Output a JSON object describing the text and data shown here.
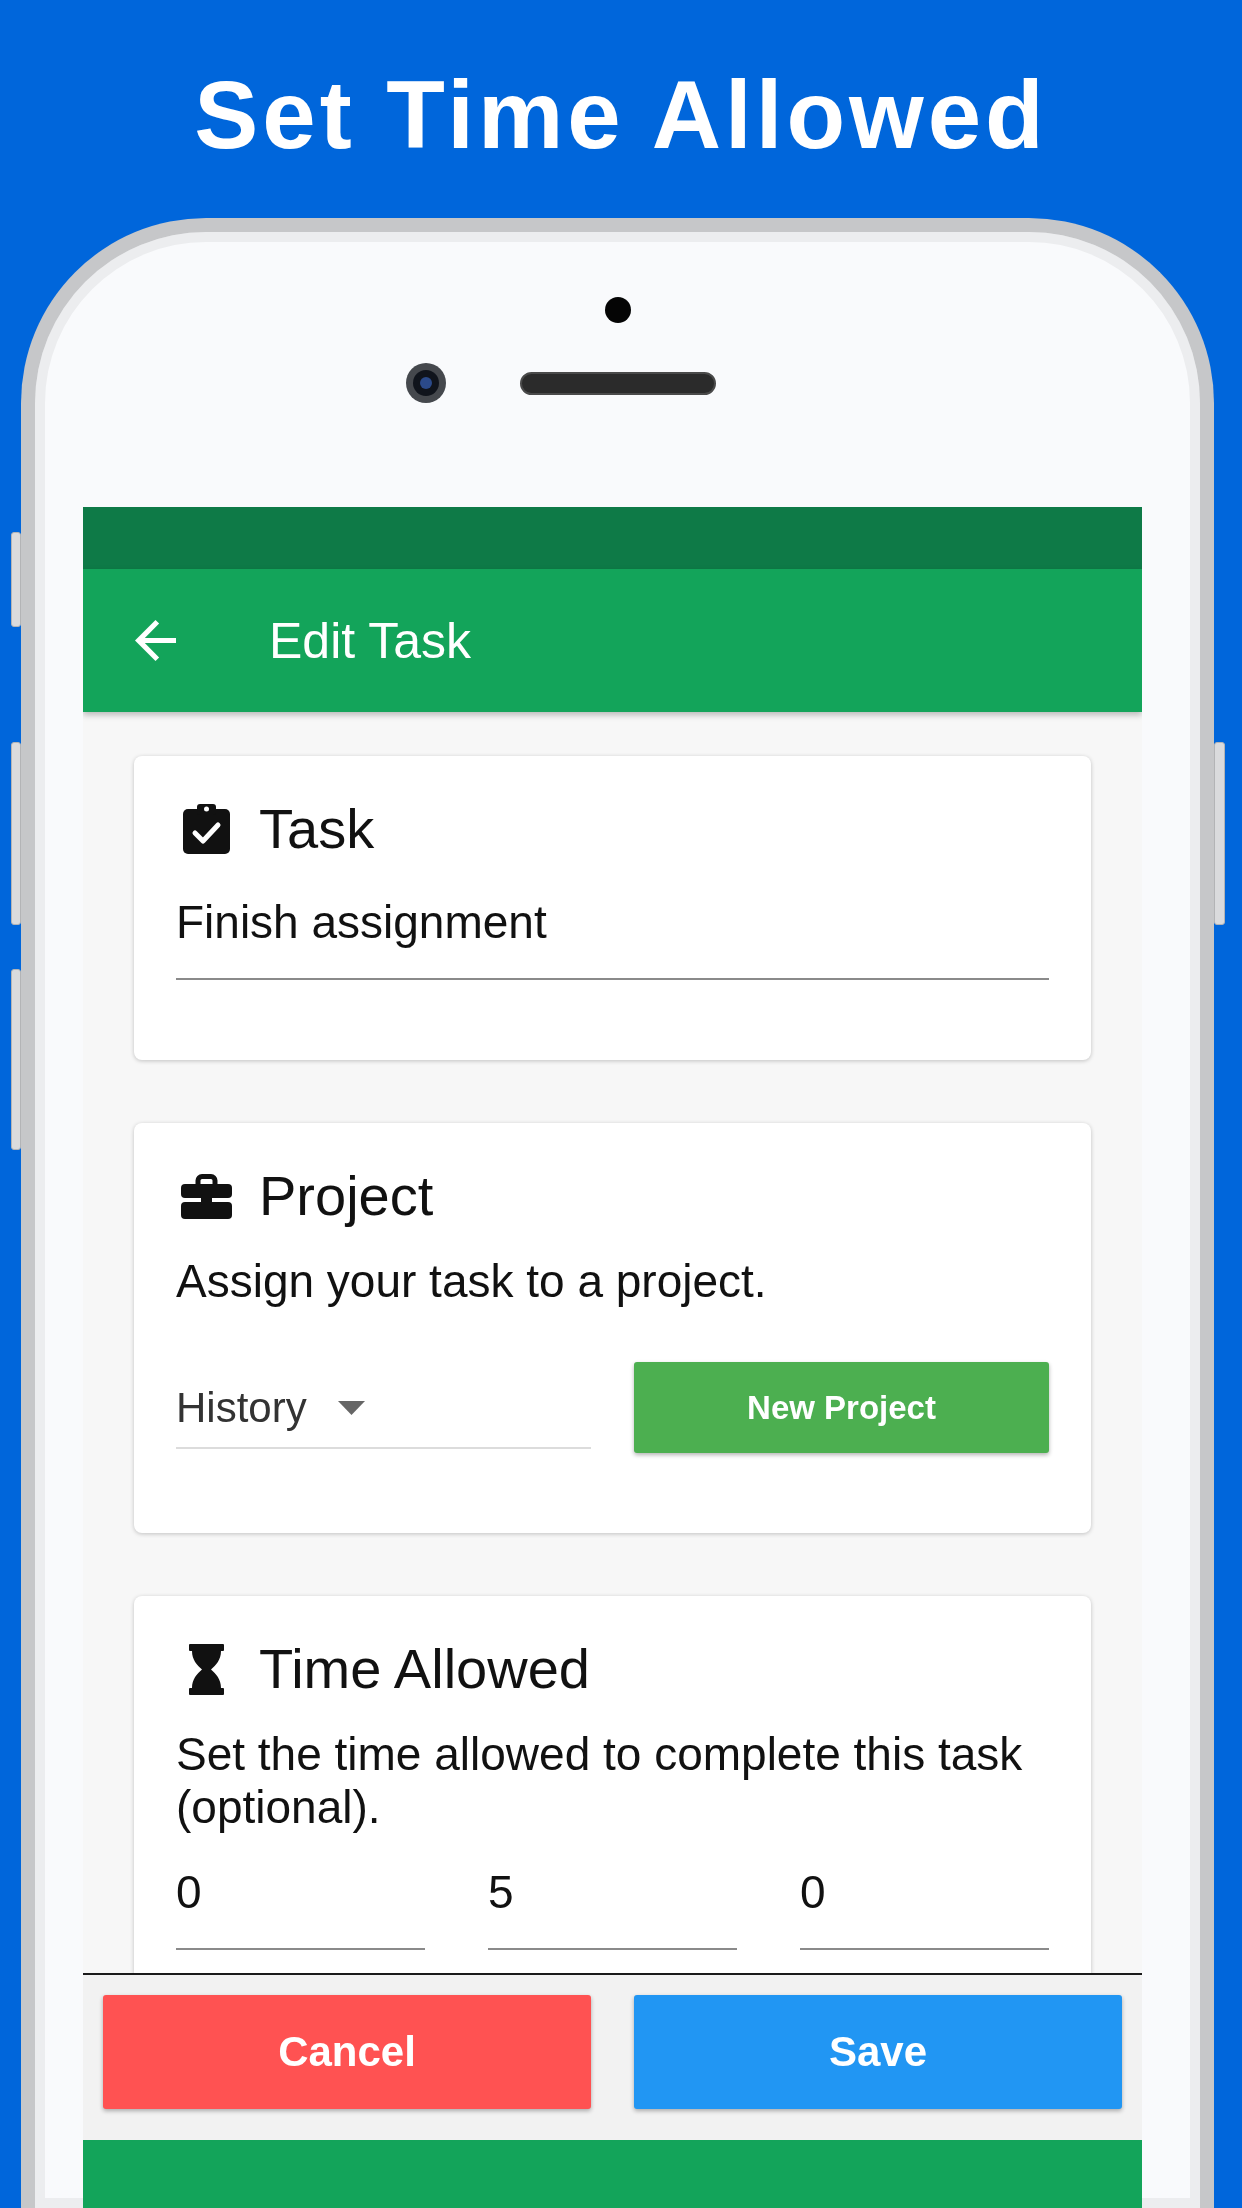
{
  "headline": "Set Time Allowed",
  "app_bar": {
    "title": "Edit Task"
  },
  "cards": [
    {
      "kind": "task",
      "title": "Task",
      "field": {
        "value": "Finish assignment"
      }
    },
    {
      "kind": "project",
      "title": "Project",
      "description": "Assign your task to a project.",
      "dropdown": {
        "value": "History"
      },
      "button": "New Project"
    },
    {
      "kind": "time",
      "title": "Time Allowed",
      "description": "Set the time allowed to complete this task (optional).",
      "fields": [
        {
          "value": "0"
        },
        {
          "value": "5"
        },
        {
          "value": "0"
        }
      ]
    }
  ],
  "actions": [
    {
      "kind": "cancel",
      "label": "Cancel"
    },
    {
      "kind": "save",
      "label": "Save"
    }
  ]
}
